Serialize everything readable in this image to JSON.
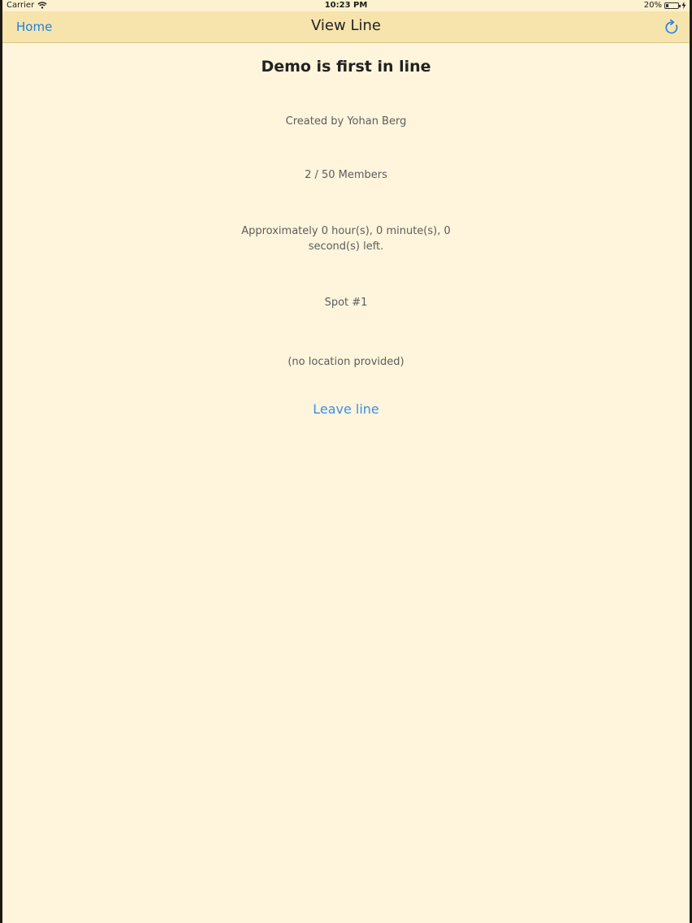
{
  "status_bar": {
    "carrier": "Carrier",
    "time": "10:23 PM",
    "battery_text": "20%",
    "battery_level": 0.2
  },
  "nav": {
    "back_label": "Home",
    "title": "View Line",
    "refresh_icon": "refresh-icon",
    "accent_color": "#1f7fe0"
  },
  "line": {
    "headline": "Demo is first in line",
    "created_by": "Created by Yohan Berg",
    "members": "2 / 50 Members",
    "time_left": "Approximately 0 hour(s), 0 minute(s), 0 second(s) left.",
    "spot": "Spot #1",
    "location": "(no location provided)",
    "leave_label": "Leave line"
  }
}
